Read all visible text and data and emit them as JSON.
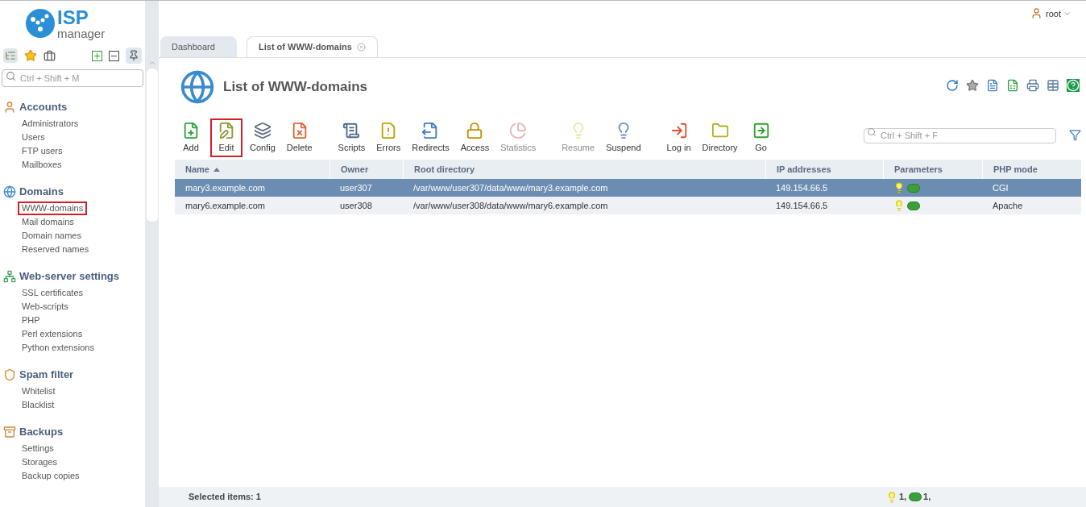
{
  "logo": {
    "top": "ISP",
    "bottom": "manager"
  },
  "user": {
    "name": "root"
  },
  "tabs": [
    {
      "label": "Dashboard",
      "selected": false,
      "closable": false
    },
    {
      "label": "List of WWW-domains",
      "selected": true,
      "closable": true
    }
  ],
  "sidebar": {
    "search": {
      "placeholder": "Ctrl + Shift + M"
    },
    "sections": [
      {
        "kind": "accounts",
        "title": "Accounts",
        "items": [
          {
            "label": "Administrators",
            "highlighted": false
          },
          {
            "label": "Users",
            "highlighted": false
          },
          {
            "label": "FTP users",
            "highlighted": false
          },
          {
            "label": "Mailboxes",
            "highlighted": false
          }
        ]
      },
      {
        "kind": "domains",
        "title": "Domains",
        "items": [
          {
            "label": "WWW-domains",
            "highlighted": true
          },
          {
            "label": "Mail domains",
            "highlighted": false
          },
          {
            "label": "Domain names",
            "highlighted": false
          },
          {
            "label": "Reserved names",
            "highlighted": false
          }
        ]
      },
      {
        "kind": "webserver",
        "title": "Web-server settings",
        "items": [
          {
            "label": "SSL certificates",
            "highlighted": false
          },
          {
            "label": "Web-scripts",
            "highlighted": false
          },
          {
            "label": "PHP",
            "highlighted": false
          },
          {
            "label": "Perl extensions",
            "highlighted": false
          },
          {
            "label": "Python extensions",
            "highlighted": false
          }
        ]
      },
      {
        "kind": "spam",
        "title": "Spam filter",
        "items": [
          {
            "label": "Whitelist",
            "highlighted": false
          },
          {
            "label": "Blacklist",
            "highlighted": false
          }
        ]
      },
      {
        "kind": "backups",
        "title": "Backups",
        "items": [
          {
            "label": "Settings",
            "highlighted": false
          },
          {
            "label": "Storages",
            "highlighted": false
          },
          {
            "label": "Backup copies",
            "highlighted": false
          }
        ]
      }
    ]
  },
  "page": {
    "title": "List of WWW-domains"
  },
  "toolbar_groups": [
    [
      {
        "kind": "add",
        "label": "Add",
        "disabled": false,
        "highlighted": false
      },
      {
        "kind": "edit",
        "label": "Edit",
        "disabled": false,
        "highlighted": true
      },
      {
        "kind": "config",
        "label": "Config",
        "disabled": false,
        "highlighted": false
      },
      {
        "kind": "delete",
        "label": "Delete",
        "disabled": false,
        "highlighted": false
      }
    ],
    [
      {
        "kind": "scripts",
        "label": "Scripts",
        "disabled": false,
        "highlighted": false
      },
      {
        "kind": "errors",
        "label": "Errors",
        "disabled": false,
        "highlighted": false
      },
      {
        "kind": "redirects",
        "label": "Redirects",
        "disabled": false,
        "highlighted": false
      },
      {
        "kind": "access",
        "label": "Access",
        "disabled": false,
        "highlighted": false
      },
      {
        "kind": "statistics",
        "label": "Statistics",
        "disabled": true,
        "highlighted": false
      }
    ],
    [
      {
        "kind": "resume",
        "label": "Resume",
        "disabled": true,
        "highlighted": false
      },
      {
        "kind": "suspend",
        "label": "Suspend",
        "disabled": false,
        "highlighted": false
      }
    ],
    [
      {
        "kind": "login",
        "label": "Log in",
        "disabled": false,
        "highlighted": false
      },
      {
        "kind": "directory",
        "label": "Directory",
        "disabled": false,
        "highlighted": false
      },
      {
        "kind": "go",
        "label": "Go",
        "disabled": false,
        "highlighted": false
      }
    ]
  ],
  "filter": {
    "placeholder": "Ctrl + Shift + F"
  },
  "table": {
    "columns": [
      {
        "label": "Name",
        "sorted": true
      },
      {
        "label": "Owner",
        "sorted": false
      },
      {
        "label": "Root directory",
        "sorted": false
      },
      {
        "label": "IP addresses",
        "sorted": false
      },
      {
        "label": "Parameters",
        "sorted": false
      },
      {
        "label": "PHP mode",
        "sorted": false
      }
    ],
    "rows": [
      {
        "selected": true,
        "name": "mary3.example.com",
        "owner": "user307",
        "root": "/var/www/user307/data/www/mary3.example.com",
        "ip": "149.154.66.5",
        "parameters": [
          {
            "kind": "bulb"
          },
          {
            "kind": "php"
          }
        ],
        "php_mode": "CGI"
      },
      {
        "selected": false,
        "name": "mary6.example.com",
        "owner": "user308",
        "root": "/var/www/user308/data/www/mary6.example.com",
        "ip": "149.154.66.5",
        "parameters": [
          {
            "kind": "bulb"
          },
          {
            "kind": "php"
          }
        ],
        "php_mode": "Apache"
      }
    ]
  },
  "status_bar": {
    "selected": "Selected items: 1",
    "totals": [
      {
        "kind": "bulb",
        "count": "1,"
      },
      {
        "kind": "php",
        "count": "1,"
      }
    ]
  }
}
